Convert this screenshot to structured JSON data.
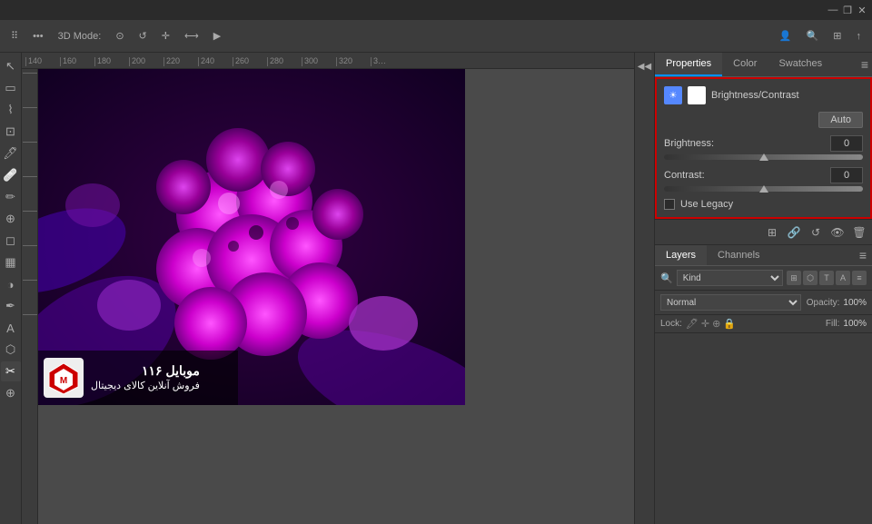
{
  "titlebar": {
    "minimize": "—",
    "restore": "❐",
    "close": "✕"
  },
  "toolbar": {
    "dots_label": "•••",
    "mode_label": "3D Mode:",
    "icons": [
      "⊙",
      "↺",
      "✛",
      "⟷",
      "📷"
    ]
  },
  "ruler": {
    "h_ticks": [
      "140",
      "160",
      "180",
      "200",
      "220",
      "240",
      "260",
      "280",
      "300",
      "320",
      "3…"
    ],
    "v_ticks": []
  },
  "left_tools": {
    "icons": [
      "▶",
      "↖",
      "✂",
      "⬡",
      "✏",
      "🔧",
      "A",
      "¶",
      "⊞",
      "⟲",
      "A",
      "✂",
      "⬡",
      "🖊",
      "⊕"
    ]
  },
  "right_tools": {
    "icons": [
      "⊞",
      "⊕",
      "↺",
      "👁",
      "🗑"
    ]
  },
  "properties_panel": {
    "tabs": [
      "Properties",
      "Color",
      "Swatches"
    ],
    "active_tab": "Properties",
    "header_title": "Brightness/Contrast",
    "auto_button": "Auto",
    "brightness_label": "Brightness:",
    "brightness_value": "0",
    "contrast_label": "Contrast:",
    "contrast_value": "0",
    "use_legacy_label": "Use Legacy"
  },
  "layers_panel": {
    "toolbar_icons": [
      "⊞",
      "🔗",
      "↺",
      "👁",
      "🗑"
    ],
    "tabs": [
      "Layers",
      "Channels"
    ],
    "active_tab": "Layers",
    "filter_label": "Kind",
    "filter_icons": [
      "⊞",
      "⬡",
      "T",
      "A",
      "≡"
    ],
    "blend_mode": "Normal",
    "opacity_label": "Opacity:",
    "opacity_value": "100%",
    "lock_label": "Lock:",
    "lock_icons": [
      "🔒",
      "🔓",
      "⊕",
      "↔"
    ],
    "fill_label": "Fill:",
    "fill_value": "100%"
  },
  "watermark": {
    "brand": "موبایل ۱۱۶",
    "sub": "فروش آنلاین کالای دیجیتال"
  }
}
